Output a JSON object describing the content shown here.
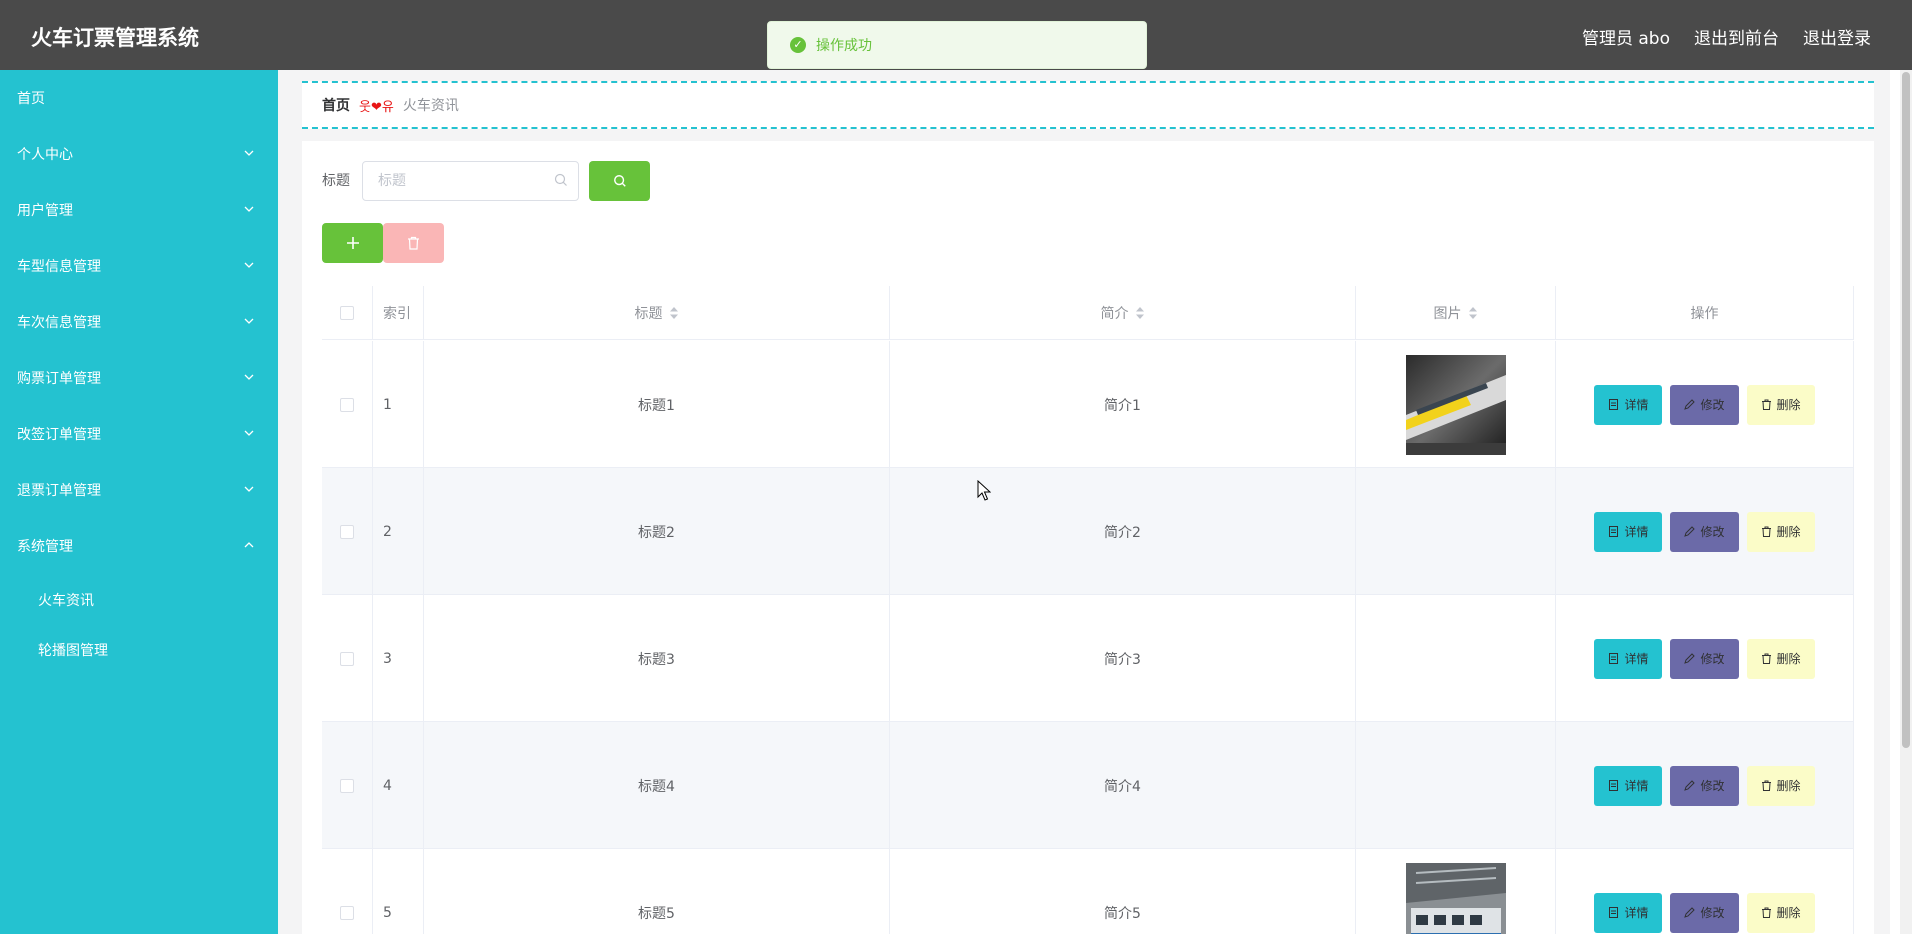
{
  "header": {
    "title": "火车订票管理系统",
    "admin_label": "管理员 abo",
    "front_label": "退出到前台",
    "logout_label": "退出登录"
  },
  "toast": {
    "message": "操作成功"
  },
  "sidebar": {
    "items": [
      {
        "label": "首页"
      },
      {
        "label": "个人中心"
      },
      {
        "label": "用户管理"
      },
      {
        "label": "车型信息管理"
      },
      {
        "label": "车次信息管理"
      },
      {
        "label": "购票订单管理"
      },
      {
        "label": "改签订单管理"
      },
      {
        "label": "退票订单管理"
      },
      {
        "label": "系统管理"
      }
    ],
    "sub_items": [
      {
        "label": "火车资讯"
      },
      {
        "label": "轮播图管理"
      }
    ]
  },
  "breadcrumb": {
    "home": "首页",
    "separator": "웃❤유",
    "current": "火车资讯"
  },
  "search": {
    "label": "标题",
    "placeholder": "标题"
  },
  "table": {
    "headers": {
      "index": "索引",
      "title": "标题",
      "intro": "简介",
      "image": "图片",
      "actions": "操作"
    },
    "rows": [
      {
        "index": "1",
        "title": "标题1",
        "intro": "简介1",
        "has_image": true
      },
      {
        "index": "2",
        "title": "标题2",
        "intro": "简介2",
        "has_image": false
      },
      {
        "index": "3",
        "title": "标题3",
        "intro": "简介3",
        "has_image": false
      },
      {
        "index": "4",
        "title": "标题4",
        "intro": "简介4",
        "has_image": false
      },
      {
        "index": "5",
        "title": "标题5",
        "intro": "简介5",
        "has_image": true
      }
    ],
    "buttons": {
      "detail": "详情",
      "edit": "修改",
      "delete": "删除"
    }
  },
  "colors": {
    "sidebar": "#24c2d0",
    "header": "#4a4a4a",
    "success": "#67c23a",
    "danger_light": "#fab6b6",
    "edit": "#6b6aa8",
    "delete": "#fbfcc8"
  },
  "icons": [
    "success-icon",
    "chevron-down-icon",
    "chevron-up-icon",
    "search-icon",
    "plus-icon",
    "trash-icon",
    "sort-icon",
    "document-icon",
    "edit-icon"
  ]
}
